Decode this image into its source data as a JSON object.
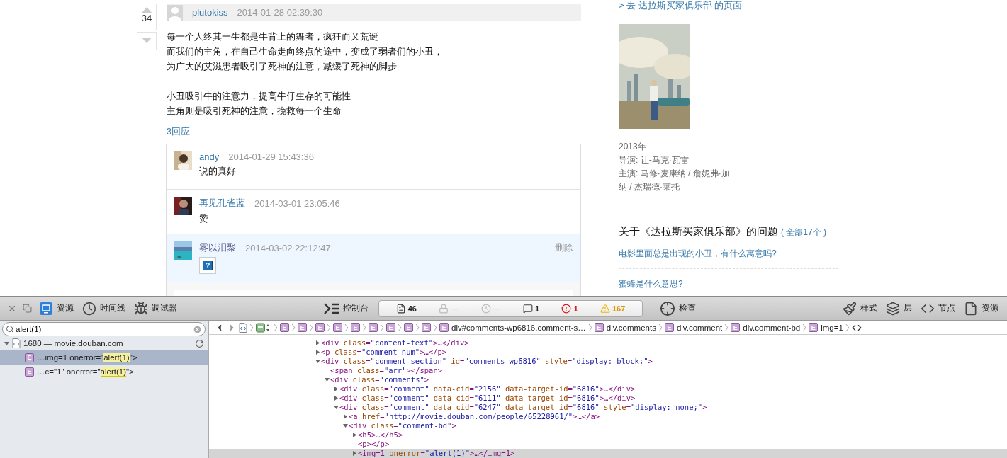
{
  "page": {
    "post": {
      "votes": "34",
      "author": "plutokiss",
      "time": "2014-01-28 02:39:30",
      "paragraphs": [
        [
          "每一个人终其一生都是牛背上的舞者，疯狂而又荒诞",
          "而我们的主角，在自己生命走向终点的途中，变成了弱者们的小丑，",
          "为广大的艾滋患者吸引了死神的注意，减缓了死神的脚步"
        ],
        [
          "小丑吸引牛的注意力，提高牛仔生存的可能性",
          "主角则是吸引死神的注意，挽救每一个生命"
        ]
      ],
      "reply_count": "3回应",
      "replies": [
        {
          "author": "andy",
          "time": "2014-01-29 15:43:36",
          "kind": "text",
          "content": "说的真好",
          "highlighted": false
        },
        {
          "author": "再见孔雀蓝",
          "time": "2014-03-01 23:05:46",
          "kind": "text",
          "content": "赞",
          "highlighted": false
        },
        {
          "author": "雾以泪聚",
          "time": "2014-03-02 22:12:47",
          "content": "?",
          "highlighted": true,
          "action": "删除"
        }
      ],
      "reply_field": {
        "kind": "input"
      }
    },
    "sidebar": {
      "movie_link": "> 去 达拉斯买家俱乐部 的页面",
      "info": [
        "2013年",
        "导演: 让-马克·瓦雷",
        "主演: 马修·麦康纳 / 詹妮弗·加纳 / 杰瑞德·莱托"
      ],
      "questions_title": "关于《达拉斯买家俱乐部》的问题",
      "questions_all": "( 全部17个 )",
      "questions": [
        "电影里面总是出现的小丑，有什么寓意吗?",
        "蜜蜂是什么意思?"
      ]
    }
  },
  "devtools": {
    "toolbar": {
      "left_tabs": [
        {
          "kind": "resources",
          "label": "资源",
          "selected": true
        },
        {
          "kind": "timeline",
          "label": "时间线",
          "selected": false
        },
        {
          "kind": "debugger",
          "label": "调试器",
          "selected": false
        }
      ],
      "console": "控制台",
      "counters": [
        {
          "kind": "document",
          "value": "46"
        },
        {
          "kind": "lock",
          "value": "—"
        },
        {
          "kind": "time",
          "value": "—"
        },
        {
          "kind": "message",
          "value": "1"
        },
        {
          "kind": "error",
          "value": "1"
        },
        {
          "kind": "warning",
          "value": "167"
        }
      ],
      "inspect": "检查",
      "right_tabs": [
        {
          "kind": "styles",
          "label": "样式"
        },
        {
          "kind": "layers",
          "label": "层"
        },
        {
          "kind": "nodes",
          "label": "节点"
        },
        {
          "kind": "resources",
          "label": "资源"
        }
      ]
    },
    "search": {
      "value": "alert(1)"
    },
    "results": [
      {
        "label": "1680 — movie.douban.com",
        "expanded": true,
        "children": [
          {
            "badge": "E",
            "before": "…img=1 onerror=\"",
            "match": "alert(1)",
            "after": "\">",
            "selected": true
          },
          {
            "badge": "E",
            "before": "…c=\"1\" onerror=\"",
            "match": "alert(1)",
            "after": "\">",
            "selected": false
          }
        ]
      }
    ],
    "breadcrumb": [
      {
        "kind": "document"
      },
      {
        "kind": "frame"
      },
      {
        "kind": "element",
        "badge": "E"
      },
      {
        "kind": "element",
        "badge": "E"
      },
      {
        "kind": "element",
        "badge": "E"
      },
      {
        "kind": "element",
        "badge": "E"
      },
      {
        "kind": "element",
        "badge": "E"
      },
      {
        "kind": "element",
        "badge": "E"
      },
      {
        "kind": "element",
        "badge": "E"
      },
      {
        "kind": "element",
        "badge": "E"
      },
      {
        "kind": "element",
        "badge": "E"
      },
      {
        "kind": "element",
        "badge": "E",
        "label": "div#comments-wp6816.comment-s…"
      },
      {
        "kind": "element",
        "badge": "E",
        "label": "div.comments"
      },
      {
        "kind": "element",
        "badge": "E",
        "label": "div.comment"
      },
      {
        "kind": "element",
        "badge": "E",
        "label": "div.comment-bd"
      },
      {
        "kind": "element",
        "badge": "E",
        "label": "img=1"
      },
      {
        "kind": "source"
      }
    ],
    "dom": [
      {
        "code": "<div class=\"content-text\">…</div>",
        "kind": "collapsed",
        "selected": false
      },
      {
        "code": "<p class=\"comment-num\">…</p>",
        "kind": "collapsed",
        "selected": false
      },
      {
        "code": "<div class=\"comment-section\" id=\"comments-wp6816\" style=\"display: block;\">",
        "kind": "expanded",
        "selected": false,
        "children": [
          {
            "code": "<span class=\"arr\"></span>",
            "kind": "leaf",
            "selected": false
          },
          {
            "code": "<div class=\"comments\">",
            "kind": "expanded",
            "selected": false,
            "children": [
              {
                "code": "<div class=\"comment\" data-cid=\"2156\" data-target-id=\"6816\">…</div>",
                "kind": "collapsed",
                "selected": false
              },
              {
                "code": "<div class=\"comment\" data-cid=\"6111\" data-target-id=\"6816\">…</div>",
                "kind": "collapsed",
                "selected": false
              },
              {
                "code": "<div class=\"comment\" data-cid=\"6247\" data-target-id=\"6816\" style=\"display: none;\">",
                "kind": "expanded",
                "selected": false,
                "children": [
                  {
                    "code": "<a href=\"http://movie.douban.com/people/65228961/\">…</a>",
                    "kind": "collapsed",
                    "selected": false
                  },
                  {
                    "code": "<div class=\"comment-bd\">",
                    "kind": "expanded",
                    "selected": false,
                    "children": [
                      {
                        "code": "<h5>…</h5>",
                        "kind": "collapsed",
                        "selected": false
                      },
                      {
                        "code": "<p></p>",
                        "kind": "leaf",
                        "selected": false
                      },
                      {
                        "code": "<img=1 onerror=\"alert(1)\">…</img=1>",
                        "kind": "collapsed",
                        "selected": true
                      }
                    ]
                  }
                ]
              }
            ]
          }
        ]
      }
    ]
  }
}
